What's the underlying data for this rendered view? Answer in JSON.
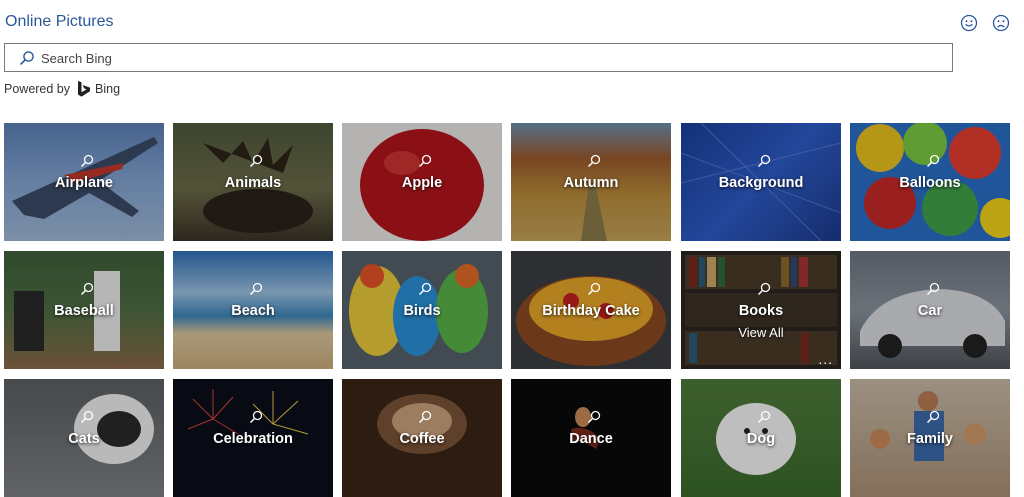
{
  "header": {
    "title": "Online Pictures"
  },
  "feedback": {
    "happy_icon": "smile-icon",
    "sad_icon": "frown-icon"
  },
  "search": {
    "placeholder": "Search Bing",
    "value": "",
    "icon": "search-icon"
  },
  "powered": {
    "prefix": "Powered by",
    "brand": "Bing",
    "logo_icon": "bing-logo-icon"
  },
  "colors": {
    "accent": "#2b579a",
    "tile_text": "#ffffff"
  },
  "tiles": [
    {
      "label": "Airplane",
      "name": "tile-airplane"
    },
    {
      "label": "Animals",
      "name": "tile-animals"
    },
    {
      "label": "Apple",
      "name": "tile-apple"
    },
    {
      "label": "Autumn",
      "name": "tile-autumn"
    },
    {
      "label": "Background",
      "name": "tile-background"
    },
    {
      "label": "Balloons",
      "name": "tile-balloons"
    },
    {
      "label": "Baseball",
      "name": "tile-baseball"
    },
    {
      "label": "Beach",
      "name": "tile-beach"
    },
    {
      "label": "Birds",
      "name": "tile-birds"
    },
    {
      "label": "Birthday Cake",
      "name": "tile-birthday-cake"
    },
    {
      "label": "Books",
      "name": "tile-books",
      "sublabel": "View All",
      "more": "..."
    },
    {
      "label": "Car",
      "name": "tile-car"
    },
    {
      "label": "Cats",
      "name": "tile-cats"
    },
    {
      "label": "Celebration",
      "name": "tile-celebration"
    },
    {
      "label": "Coffee",
      "name": "tile-coffee"
    },
    {
      "label": "Dance",
      "name": "tile-dance"
    },
    {
      "label": "Dog",
      "name": "tile-dog"
    },
    {
      "label": "Family",
      "name": "tile-family"
    }
  ]
}
